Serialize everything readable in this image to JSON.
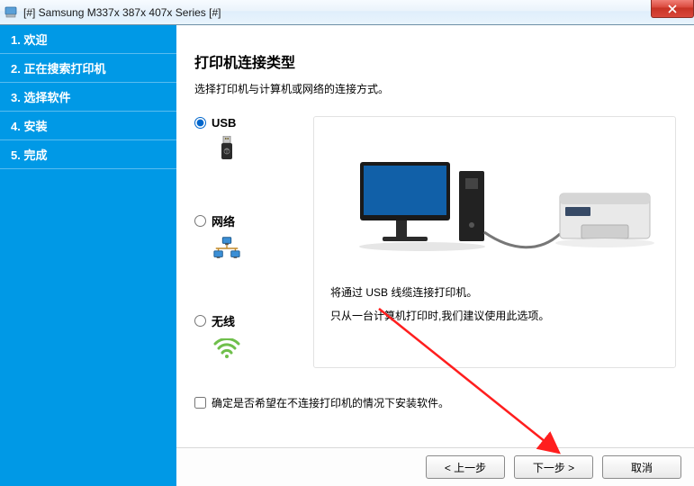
{
  "window": {
    "title": "[#] Samsung M337x 387x 407x Series [#]"
  },
  "sidebar": {
    "steps": [
      {
        "label": "1. 欢迎"
      },
      {
        "label": "2. 正在搜索打印机"
      },
      {
        "label": "3. 选择软件"
      },
      {
        "label": "4. 安装"
      },
      {
        "label": "5. 完成"
      }
    ]
  },
  "page": {
    "title": "打印机连接类型",
    "subtitle": "选择打印机与计算机或网络的连接方式。"
  },
  "options": {
    "usb": {
      "label": "USB"
    },
    "network": {
      "label": "网络"
    },
    "wireless": {
      "label": "无线"
    },
    "selected": "usb"
  },
  "visual": {
    "line1": "将通过 USB 线缆连接打印机。",
    "line2": "只从一台计算机打印时,我们建议使用此选项。"
  },
  "install_check": {
    "label": "确定是否希望在不连接打印机的情况下安装软件。"
  },
  "buttons": {
    "back": "< 上一步",
    "next": "下一步 >",
    "cancel": "取消"
  }
}
